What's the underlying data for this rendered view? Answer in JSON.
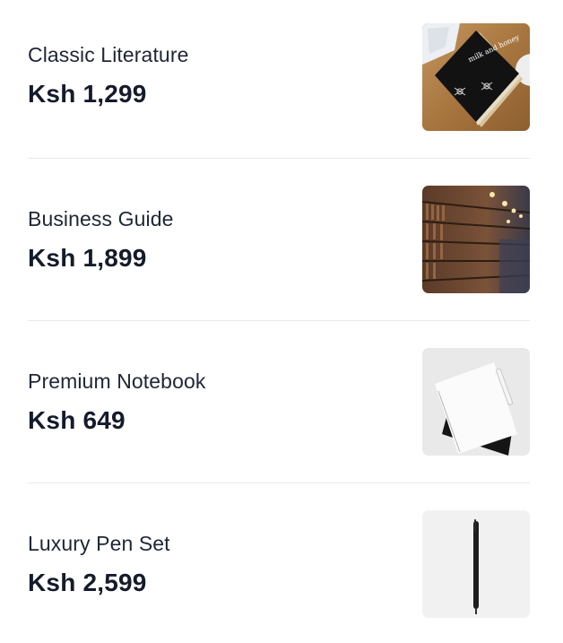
{
  "products": [
    {
      "name": "Classic Literature",
      "price": "Ksh 1,299",
      "image_icon": "book-cover-image",
      "image_text": "milk and honey"
    },
    {
      "name": "Business Guide",
      "price": "Ksh 1,899",
      "image_icon": "library-shelves-image"
    },
    {
      "name": "Premium Notebook",
      "price": "Ksh 649",
      "image_icon": "notebook-image"
    },
    {
      "name": "Luxury Pen Set",
      "price": "Ksh 2,599",
      "image_icon": "pen-image"
    }
  ],
  "colors": {
    "text": "#1f2636",
    "price": "#141b2b",
    "divider": "#e6e8ec"
  }
}
